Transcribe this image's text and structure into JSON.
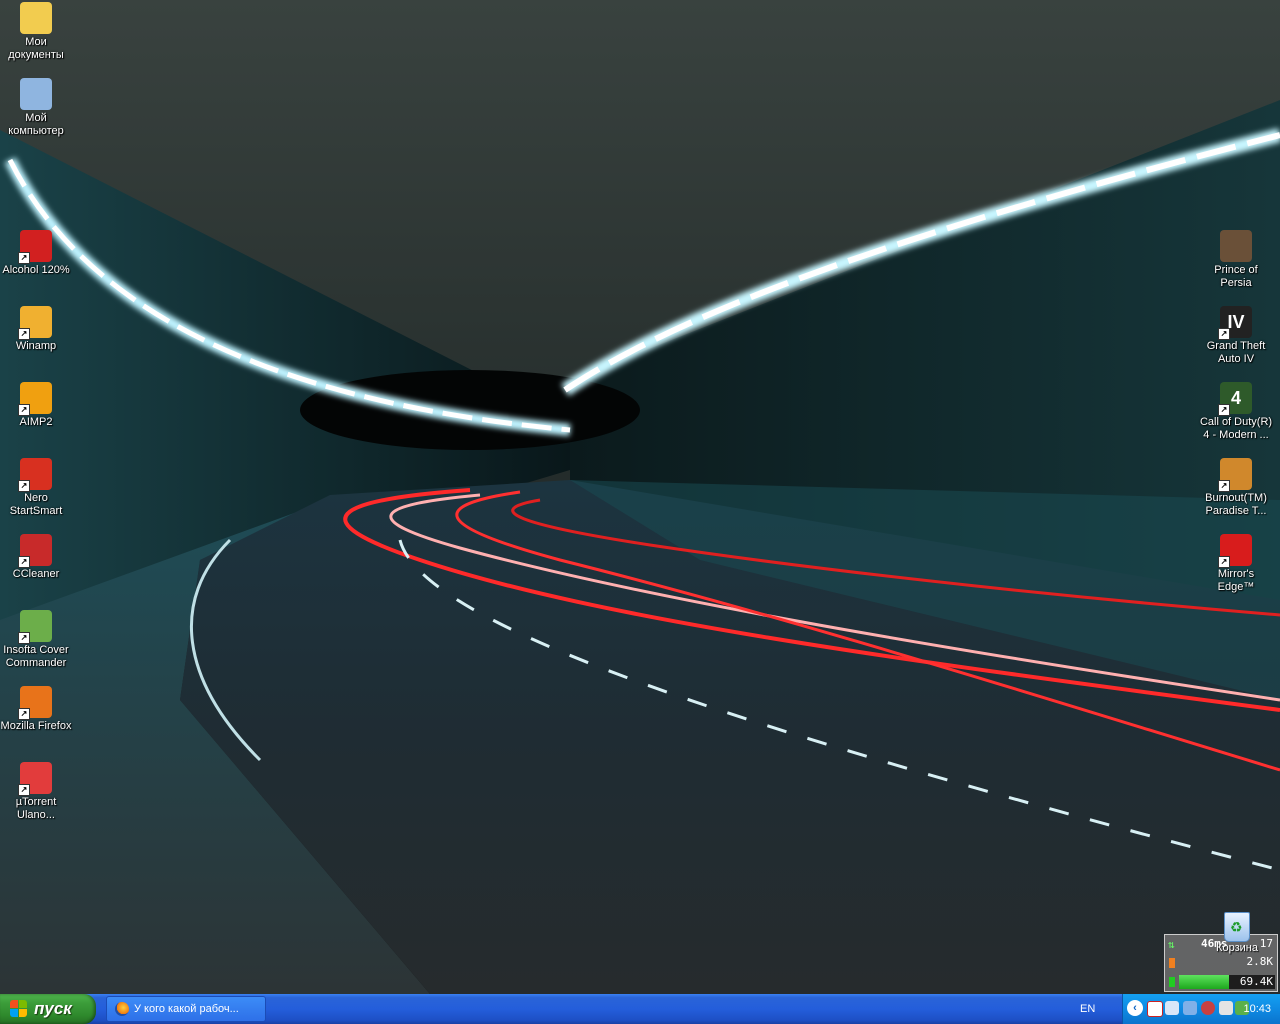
{
  "desktop": {
    "left_icons": [
      {
        "label": "Мои документы",
        "icon": "folder-documents-icon",
        "color": "#f2cc4f",
        "shortcut": false
      },
      {
        "label": "Мой компьютер",
        "icon": "computer-icon",
        "color": "#8fb5e0",
        "shortcut": false
      },
      {
        "label": "Alcohol 120%",
        "icon": "alcohol-120-icon",
        "color": "#d22020",
        "shortcut": true
      },
      {
        "label": "Winamp",
        "icon": "winamp-icon",
        "color": "#f0b030",
        "shortcut": true
      },
      {
        "label": "AIMP2",
        "icon": "aimp-icon",
        "color": "#f0a010",
        "shortcut": true
      },
      {
        "label": "Nero StartSmart",
        "icon": "nero-icon",
        "color": "#d83020",
        "shortcut": true
      },
      {
        "label": "CCleaner",
        "icon": "ccleaner-icon",
        "color": "#c82a2a",
        "shortcut": true
      },
      {
        "label": "Insofta Cover Commander",
        "icon": "cover-commander-icon",
        "color": "#6cae4a",
        "shortcut": true
      },
      {
        "label": "Mozilla Firefox",
        "icon": "firefox-icon",
        "color": "#e8731a",
        "shortcut": true
      },
      {
        "label": "µTorrent Ulano...",
        "icon": "utorrent-icon",
        "color": "#e23c3c",
        "shortcut": true
      }
    ],
    "right_icons": [
      {
        "label": "Prince of Persia",
        "icon": "prince-of-persia-icon",
        "color": "#6a5038",
        "shortcut": false
      },
      {
        "label": "Grand Theft Auto IV",
        "icon": "gta-iv-icon",
        "color": "#222222",
        "shortcut": true,
        "text": "IV"
      },
      {
        "label": "Call of Duty(R) 4 - Modern ...",
        "icon": "call-of-duty-icon",
        "color": "#2e5a2a",
        "shortcut": true,
        "text": "4"
      },
      {
        "label": "Burnout(TM) Paradise T...",
        "icon": "burnout-paradise-icon",
        "color": "#d0882c",
        "shortcut": true
      },
      {
        "label": "Mirror's Edge™",
        "icon": "mirrors-edge-icon",
        "color": "#d81c1c",
        "shortcut": true
      }
    ],
    "recycle_bin": {
      "label": "Корзина",
      "icon": "recycle-bin-icon"
    }
  },
  "net_meter": {
    "ping": "46ms",
    "count": "17",
    "upload": "2.8K",
    "download": "69.4K",
    "bar_fraction": 0.52
  },
  "taskbar": {
    "start_label": "пуск",
    "task_label": "У кого какой рабоч...",
    "language": "EN",
    "clock": "10:43",
    "tray_chevron": "‹"
  },
  "colors": {
    "taskbar_blue": "#245edb",
    "start_green": "#3c9d3a",
    "tray_blue": "#0f8ae3"
  }
}
